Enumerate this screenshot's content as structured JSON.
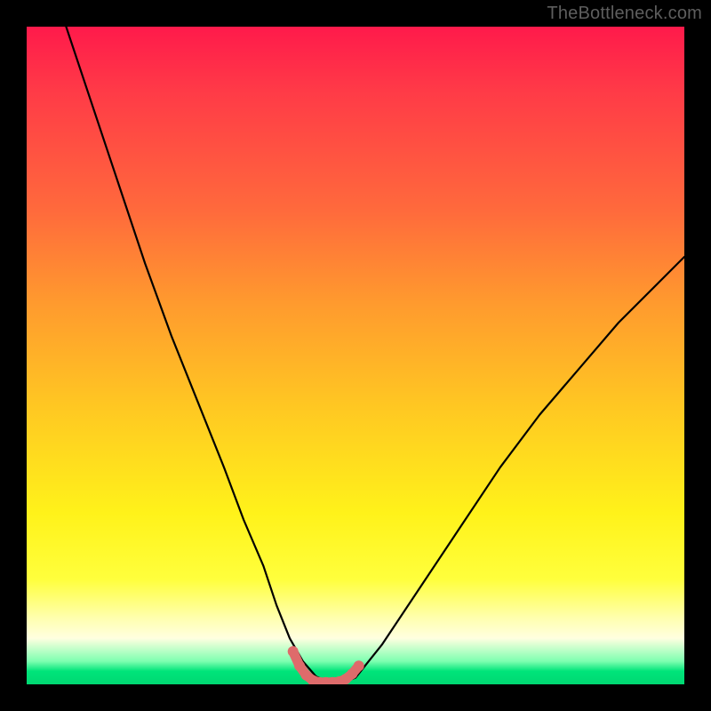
{
  "watermark": "TheBottleneck.com",
  "chart_data": {
    "type": "line",
    "title": "",
    "xlabel": "",
    "ylabel": "",
    "xlim": [
      0,
      100
    ],
    "ylim": [
      0,
      100
    ],
    "series": [
      {
        "name": "bottleneck-curve",
        "color": "#000000",
        "x": [
          6,
          10,
          14,
          18,
          22,
          26,
          30,
          33,
          36,
          38,
          40,
          42,
          44,
          46,
          48,
          50,
          54,
          60,
          66,
          72,
          78,
          84,
          90,
          96,
          100
        ],
        "values": [
          100,
          88,
          76,
          64,
          53,
          43,
          33,
          25,
          18,
          12,
          7,
          3.5,
          1.2,
          0.3,
          0.3,
          1.0,
          6,
          15,
          24,
          33,
          41,
          48,
          55,
          61,
          65
        ]
      },
      {
        "name": "trough-highlight",
        "color": "#de6b6b",
        "x": [
          40.5,
          41.5,
          42.5,
          43.5,
          44.5,
          45.5,
          46.5,
          47.5,
          48.5,
          49.5,
          50.5
        ],
        "values": [
          5.0,
          2.8,
          1.4,
          0.6,
          0.3,
          0.3,
          0.3,
          0.4,
          0.8,
          1.6,
          2.8
        ]
      }
    ],
    "gradient_stops": [
      {
        "pos": 0,
        "color": "#ff1a4b"
      },
      {
        "pos": 0.1,
        "color": "#ff3b47"
      },
      {
        "pos": 0.28,
        "color": "#ff6a3c"
      },
      {
        "pos": 0.42,
        "color": "#ff9a2e"
      },
      {
        "pos": 0.58,
        "color": "#ffc822"
      },
      {
        "pos": 0.74,
        "color": "#fff21a"
      },
      {
        "pos": 0.84,
        "color": "#ffff3c"
      },
      {
        "pos": 0.9,
        "color": "#ffffb0"
      },
      {
        "pos": 0.93,
        "color": "#ffffe0"
      },
      {
        "pos": 0.965,
        "color": "#7dffb0"
      },
      {
        "pos": 0.98,
        "color": "#00e47a"
      },
      {
        "pos": 1.0,
        "color": "#00d872"
      }
    ]
  }
}
